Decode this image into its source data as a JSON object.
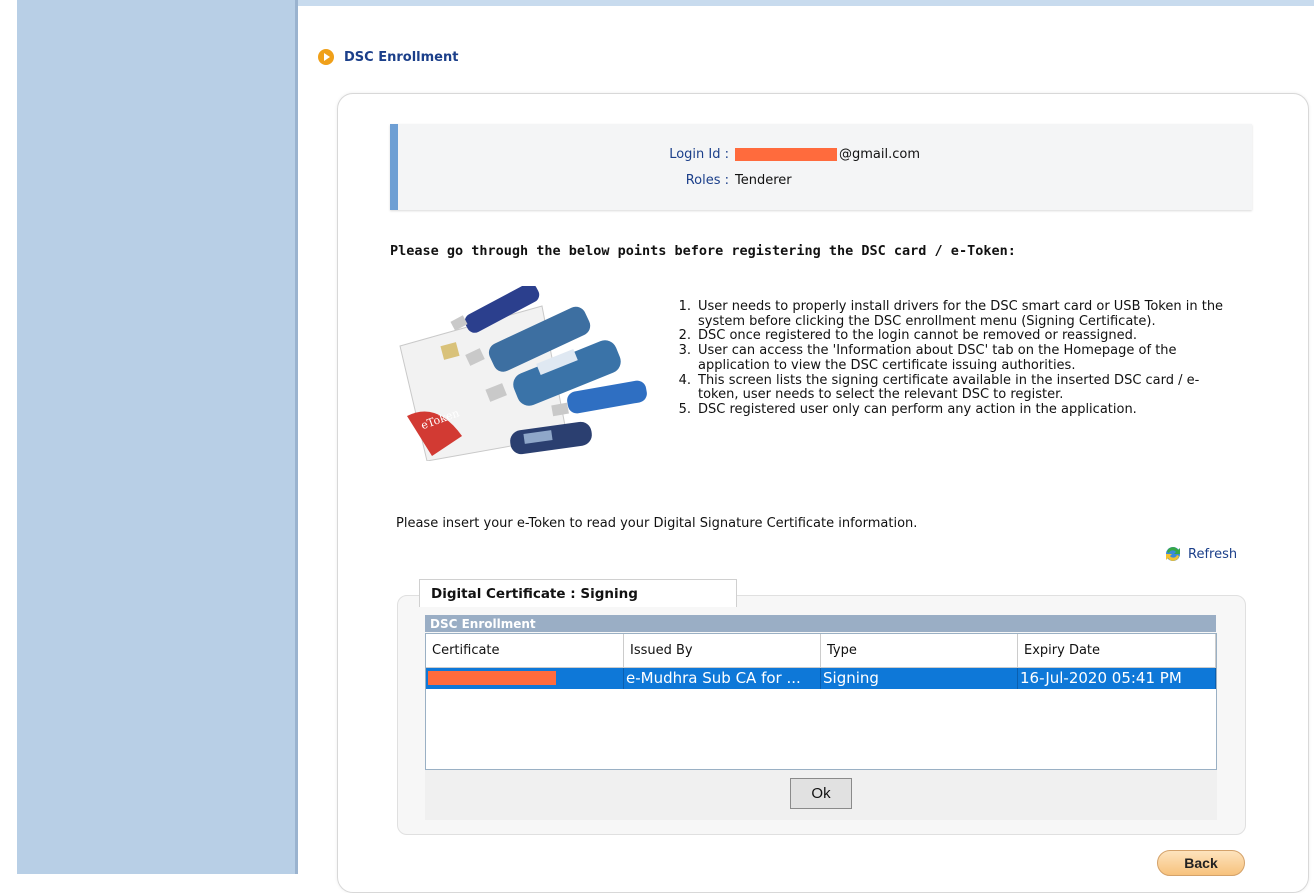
{
  "page": {
    "title": "DSC Enrollment"
  },
  "login": {
    "login_id_label": "Login Id :",
    "login_id_value": "@gmail.com",
    "roles_label": "Roles :",
    "roles_value": "Tenderer"
  },
  "instructions": {
    "heading": "Please go through the below points before registering the DSC card / e-Token:",
    "image_caption": "eToken",
    "points": [
      {
        "num": "1.",
        "text": "User needs to properly install drivers for the DSC smart card or USB Token in the system before clicking the DSC enrollment menu (Signing Certificate)."
      },
      {
        "num": "2.",
        "text": "DSC once registered to the login cannot be removed or reassigned."
      },
      {
        "num": "3.",
        "text": "User can access the 'Information about DSC' tab on the Homepage of the application to view the DSC certificate issuing authorities."
      },
      {
        "num": "4.",
        "text": "This screen lists the signing certificate available in the inserted DSC card / e-token, user needs to select the relevant DSC to register."
      },
      {
        "num": "5.",
        "text": "DSC registered user only can perform any action in the application."
      }
    ]
  },
  "insert_message": "Please insert your e-Token to read your Digital Signature Certificate information.",
  "refresh_label": "Refresh",
  "certificate": {
    "tab_label": "Digital Certificate : Signing",
    "bar_title": "DSC Enrollment",
    "columns": [
      "Certificate",
      "Issued By",
      "Type",
      "Expiry Date"
    ],
    "rows": [
      {
        "certificate": "",
        "issued_by": "e-Mudhra Sub CA for ...",
        "type": "Signing",
        "expiry": "16-Jul-2020 05:41 PM"
      }
    ],
    "ok_label": "Ok"
  },
  "back_label": "Back",
  "colors": {
    "sidebar": "#b8cfe6",
    "accent_blue": "#1b3f8a",
    "selected_row": "#0e78d8",
    "redaction": "#ff6b3d",
    "title_icon": "#f0a019"
  }
}
